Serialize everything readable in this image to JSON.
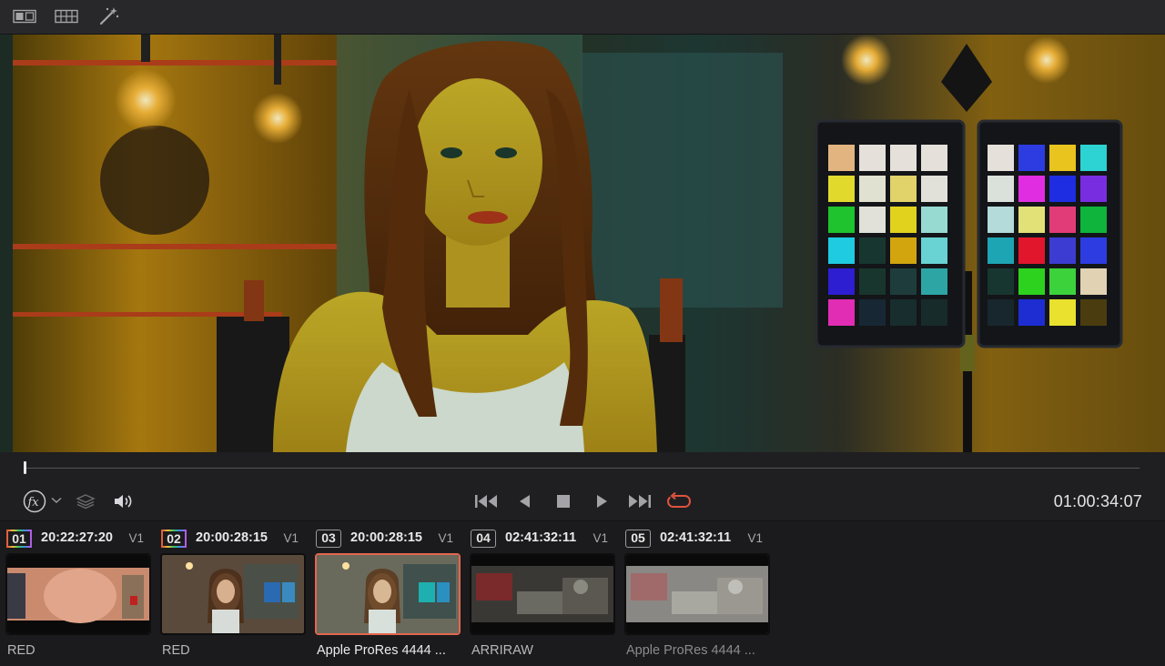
{
  "toolbar": {
    "buttons": [
      {
        "name": "single-viewer-icon"
      },
      {
        "name": "clip-grid-icon"
      },
      {
        "name": "magic-wand-icon"
      }
    ]
  },
  "viewer": {
    "scene": "woman seated in director chair with color checker chart, warm yellow grade"
  },
  "transport": {
    "icons": [
      "fx-icon",
      "chevron-down-icon",
      "layers-icon",
      "speaker-icon",
      "skip-to-start-icon",
      "step-back-icon",
      "stop-icon",
      "play-icon",
      "skip-to-end-icon",
      "loop-icon"
    ],
    "timecode": "01:00:34:07",
    "loop_color": "#e0533c",
    "playhead_progress": 0.0
  },
  "clips": [
    {
      "num": "01",
      "timecode": "20:22:27:20",
      "track": "V1",
      "label": "RED",
      "selected": false
    },
    {
      "num": "02",
      "timecode": "20:00:28:15",
      "track": "V1",
      "label": "RED",
      "selected": false
    },
    {
      "num": "03",
      "timecode": "20:00:28:15",
      "track": "V1",
      "label": "Apple ProRes 4444 ...",
      "selected": true
    },
    {
      "num": "04",
      "timecode": "02:41:32:11",
      "track": "V1",
      "label": "ARRIRAW",
      "selected": false
    },
    {
      "num": "05",
      "timecode": "02:41:32:11",
      "track": "V1",
      "label": "Apple ProRes 4444 ...",
      "selected": false
    }
  ],
  "colors": {
    "selection_border": "#e2674f",
    "background": "#1e1e20"
  }
}
